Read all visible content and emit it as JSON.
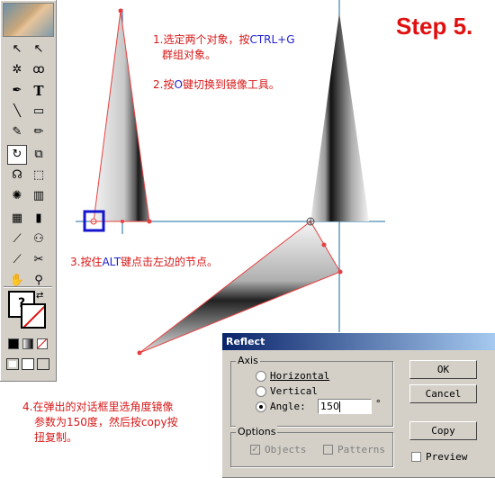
{
  "step_label": "Step 5.",
  "notes": {
    "note1_a": "1.选定两个对象，按",
    "note1_b": "CTRL+G",
    "note1_c": "群组对象。",
    "note2_a": "2.按",
    "note2_b": "O",
    "note2_c": "键切换到镜像工具。",
    "note3_a": "3.按住",
    "note3_b": "ALT",
    "note3_c": "键点击左边的节点。",
    "note4_line1": "4.在弹出的对话框里选角度镜像",
    "note4_line2": "参数为150度，然后按copy按",
    "note4_line3": "扭复制。"
  },
  "toolbox": {
    "tools": [
      {
        "name": "selection-tool-icon",
        "glyph": "↖"
      },
      {
        "name": "direct-selection-tool-icon",
        "glyph": "↖"
      },
      {
        "name": "magic-wand-tool-icon",
        "glyph": "✲"
      },
      {
        "name": "lasso-tool-icon",
        "glyph": "ꝏ"
      },
      {
        "name": "pen-tool-icon",
        "glyph": "✒"
      },
      {
        "name": "type-tool-icon",
        "glyph": "T"
      },
      {
        "name": "line-tool-icon",
        "glyph": "╲"
      },
      {
        "name": "rectangle-tool-icon",
        "glyph": "▭"
      },
      {
        "name": "paintbrush-tool-icon",
        "glyph": "✎"
      },
      {
        "name": "pencil-tool-icon",
        "glyph": "✏"
      },
      {
        "name": "rotate-tool-icon",
        "glyph": "↻"
      },
      {
        "name": "scale-tool-icon",
        "glyph": "⧉"
      },
      {
        "name": "warp-tool-icon",
        "glyph": "☊"
      },
      {
        "name": "free-transform-tool-icon",
        "glyph": "⬚"
      },
      {
        "name": "symbol-sprayer-tool-icon",
        "glyph": "✺"
      },
      {
        "name": "column-graph-tool-icon",
        "glyph": "▥"
      },
      {
        "name": "mesh-tool-icon",
        "glyph": "▦"
      },
      {
        "name": "gradient-tool-icon",
        "glyph": "▮"
      },
      {
        "name": "eyedropper-tool-icon",
        "glyph": "⟋"
      },
      {
        "name": "blend-tool-icon",
        "glyph": "⚇"
      },
      {
        "name": "slice-tool-icon",
        "glyph": "⟋"
      },
      {
        "name": "scissors-tool-icon",
        "glyph": "✂"
      },
      {
        "name": "hand-tool-icon",
        "glyph": "✋"
      },
      {
        "name": "zoom-tool-icon",
        "glyph": "⚲"
      }
    ],
    "help_glyph": "?"
  },
  "dialog": {
    "title": "Reflect",
    "axis_label": "Axis",
    "horizontal_label": "Horizontal",
    "vertical_label": "Vertical",
    "angle_label": "Angle:",
    "angle_value": "150",
    "degree_symbol": "°",
    "options_label": "Options",
    "objects_label": "Objects",
    "patterns_label": "Patterns",
    "ok_label": "OK",
    "cancel_label": "Cancel",
    "copy_label": "Copy",
    "preview_label": "Preview",
    "selected_axis": "angle"
  },
  "colors": {
    "annotation_red": "#d81818",
    "annotation_blue": "#2020d0",
    "highlight_red": "#e01010",
    "guide_blue": "#1a6ea0"
  }
}
